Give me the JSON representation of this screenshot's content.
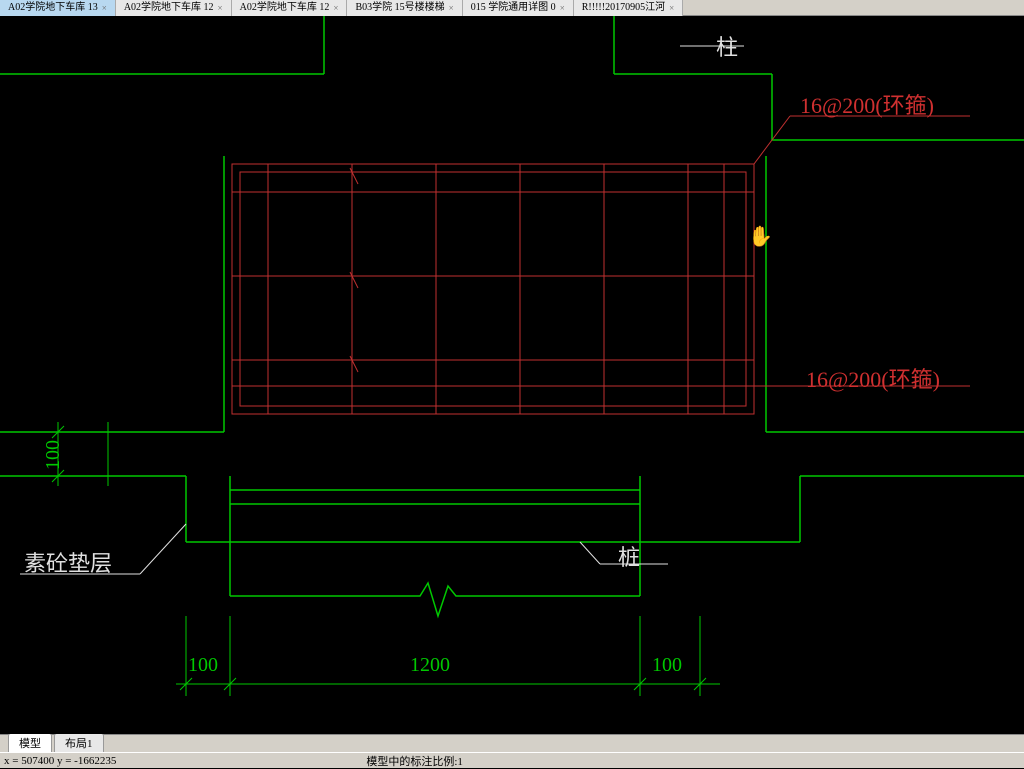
{
  "tabs_top": [
    {
      "label": "A02学院地下车库  13",
      "active": true
    },
    {
      "label": "A02学院地下车库  12",
      "active": false
    },
    {
      "label": "A02学院地下车库  12",
      "active": false
    },
    {
      "label": "B03学院 15号楼楼梯",
      "active": false
    },
    {
      "label": "015 学院通用详图  0",
      "active": false
    },
    {
      "label": "R!!!!!20170905江河",
      "active": false
    }
  ],
  "labels": {
    "column_top": "柱",
    "annot_1": "16@200(环箍)",
    "annot_2": "16@200(环箍)",
    "bedding": "素砼垫层",
    "pile": "桩"
  },
  "dims": {
    "d100_left_v": "100",
    "d100_bl": "100",
    "d1200": "1200",
    "d100_br": "100"
  },
  "tabs_bottom": {
    "model": "模型",
    "layout1": "布局1"
  },
  "status": {
    "coords": "x = 507400  y = -1662235",
    "scale": "模型中的标注比例:1"
  },
  "icons": {
    "close": "×"
  }
}
